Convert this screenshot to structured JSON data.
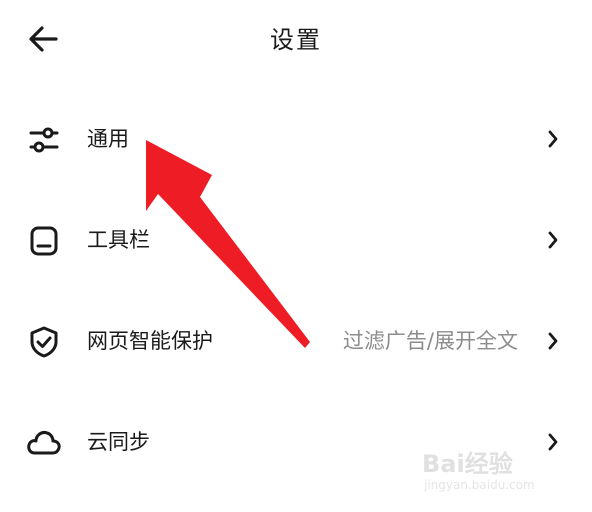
{
  "header": {
    "title": "设置",
    "back_icon": "arrow-left-icon"
  },
  "settings": {
    "items": [
      {
        "label": "通用",
        "value": "",
        "icon": "sliders-icon"
      },
      {
        "label": "工具栏",
        "value": "",
        "icon": "toolbar-icon"
      },
      {
        "label": "网页智能保护",
        "value": "过滤广告/展开全文",
        "icon": "shield-check-icon"
      },
      {
        "label": "云同步",
        "value": "",
        "icon": "cloud-icon"
      }
    ]
  },
  "annotation": {
    "color": "#ee1c25"
  },
  "watermark": {
    "text": "Bai经验",
    "url": "jingyan.baidu.com"
  }
}
